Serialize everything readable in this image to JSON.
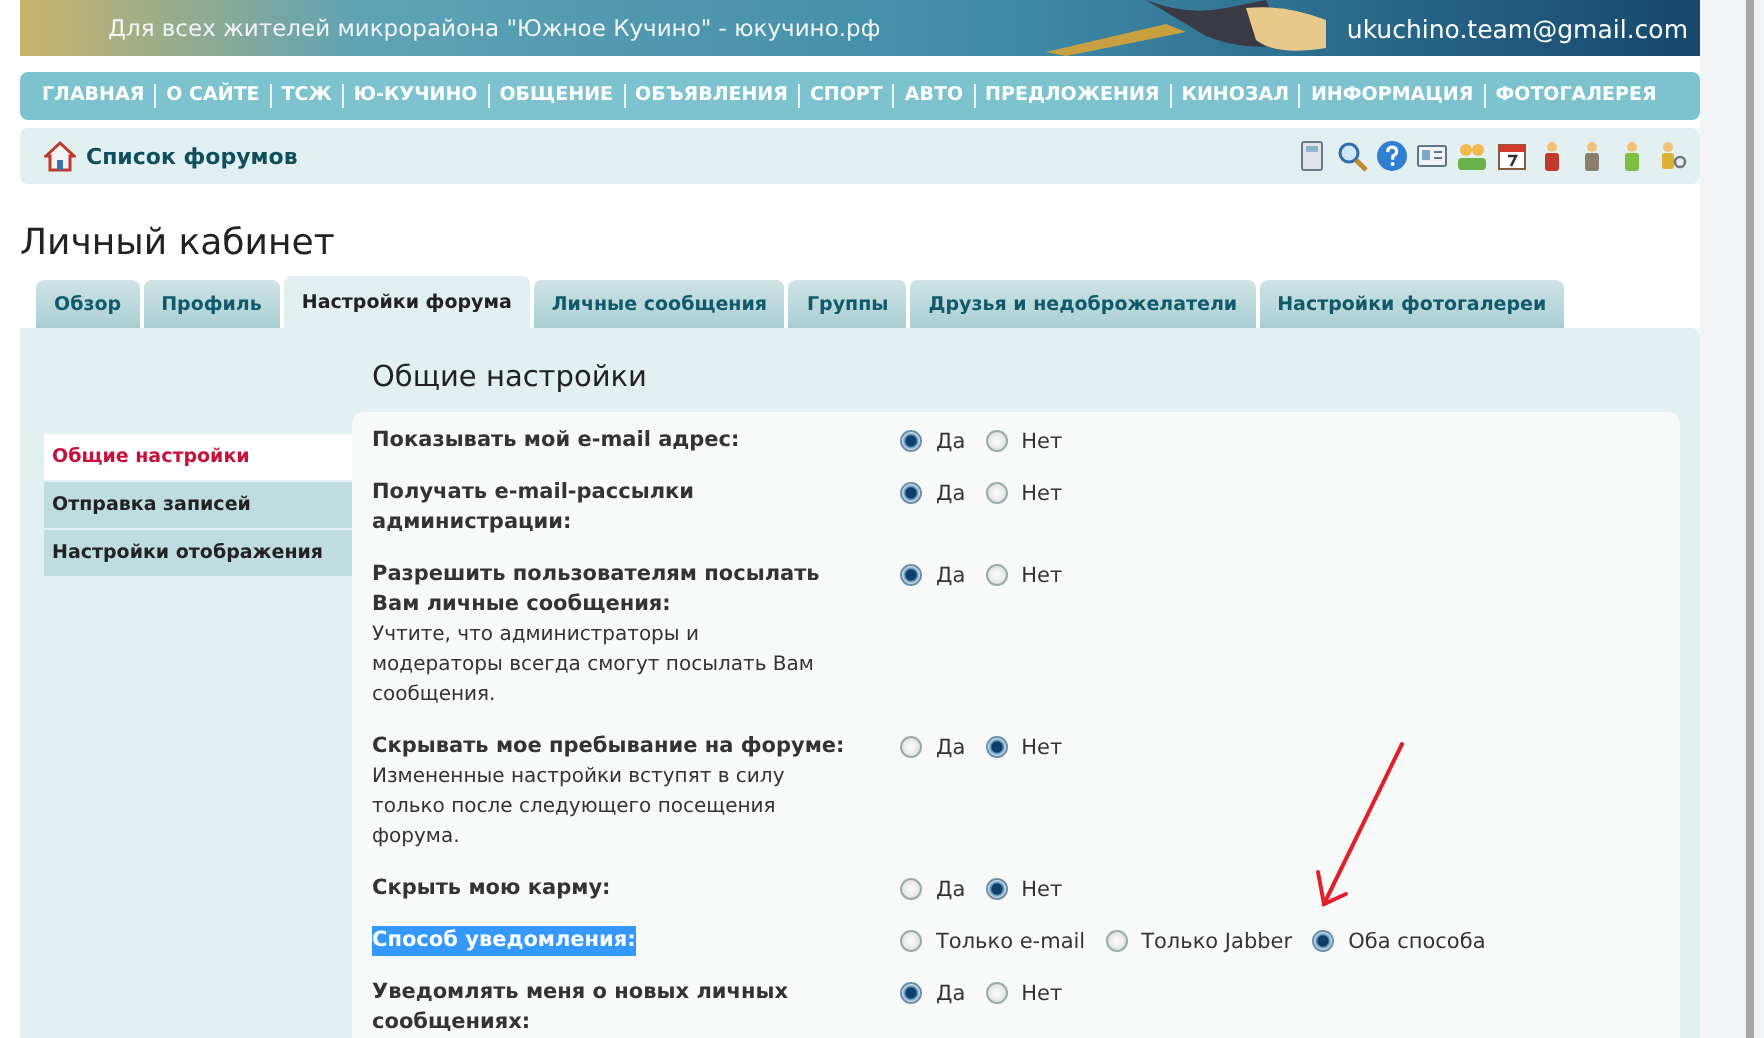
{
  "header": {
    "tagline": "Для всех жителей микрорайона \"Южное Кучино\" - юкучино.рф",
    "email": "ukuchino.team@gmail.com"
  },
  "nav": [
    "ГЛАВНАЯ",
    "О САЙТЕ",
    "ТСЖ",
    "Ю-КУЧИНО",
    "ОБЩЕНИЕ",
    "ОБЪЯВЛЕНИЯ",
    "СПОРТ",
    "АВТО",
    "ПРЕДЛОЖЕНИЯ",
    "КИНОЗАЛ",
    "ИНФОРМАЦИЯ",
    "ФОТОГАЛЕРЕЯ"
  ],
  "breadcrumb": {
    "label": "Список форумов"
  },
  "page_title": "Личный кабинет",
  "tabs": [
    {
      "label": "Обзор",
      "selected": false
    },
    {
      "label": "Профиль",
      "selected": false
    },
    {
      "label": "Настройки форума",
      "selected": true
    },
    {
      "label": "Личные сообщения",
      "selected": false
    },
    {
      "label": "Группы",
      "selected": false
    },
    {
      "label": "Друзья и недоброжелатели",
      "selected": false
    },
    {
      "label": "Настройки фотогалереи",
      "selected": false
    }
  ],
  "section_title": "Общие настройки",
  "sidebar": {
    "items": [
      {
        "label": "Общие настройки",
        "selected": true
      },
      {
        "label": "Отправка записей",
        "selected": false
      },
      {
        "label": "Настройки отображения",
        "selected": false
      }
    ]
  },
  "settings": [
    {
      "label": "Показывать мой e-mail адрес:",
      "highlighted": false,
      "options": [
        {
          "label": "Да",
          "selected": true
        },
        {
          "label": "Нет",
          "selected": false
        }
      ]
    },
    {
      "label": "Получать e-mail-рассылки администрации:",
      "highlighted": false,
      "options": [
        {
          "label": "Да",
          "selected": true
        },
        {
          "label": "Нет",
          "selected": false
        }
      ]
    },
    {
      "label": "Разрешить пользователям посылать Вам личные сообщения:",
      "note": "Учтите, что администраторы и модераторы всегда смогут посылать Вам сообщения.",
      "highlighted": false,
      "options": [
        {
          "label": "Да",
          "selected": true
        },
        {
          "label": "Нет",
          "selected": false
        }
      ]
    },
    {
      "label": "Скрывать мое пребывание на форуме:",
      "note": "Измененные настройки вступят в силу только после следующего посещения форума.",
      "highlighted": false,
      "options": [
        {
          "label": "Да",
          "selected": false
        },
        {
          "label": "Нет",
          "selected": true
        }
      ]
    },
    {
      "label": "Скрыть мою карму:",
      "highlighted": false,
      "options": [
        {
          "label": "Да",
          "selected": false
        },
        {
          "label": "Нет",
          "selected": true
        }
      ]
    },
    {
      "label": "Способ уведомления:",
      "highlighted": true,
      "options": [
        {
          "label": "Только e-mail",
          "selected": false
        },
        {
          "label": "Только Jabber",
          "selected": false
        },
        {
          "label": "Оба способа",
          "selected": true
        }
      ]
    },
    {
      "label": "Уведомлять меня о новых личных сообщениях:",
      "highlighted": false,
      "options": [
        {
          "label": "Да",
          "selected": true
        },
        {
          "label": "Нет",
          "selected": false
        }
      ]
    }
  ]
}
